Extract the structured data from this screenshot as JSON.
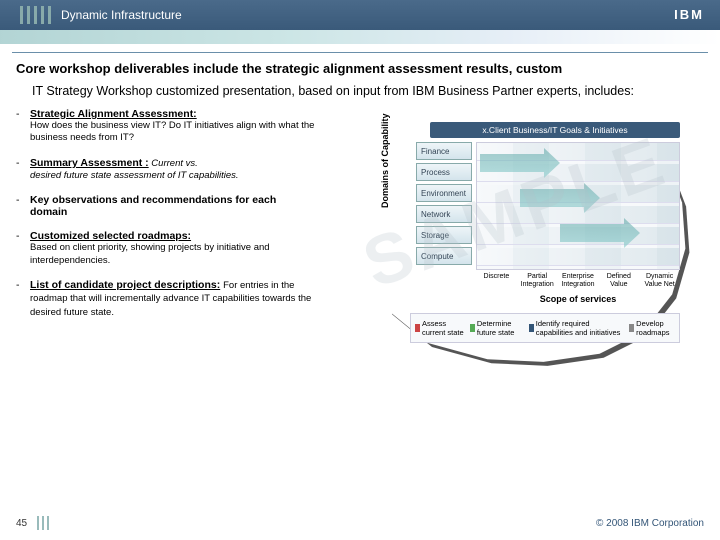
{
  "header": {
    "title": "Dynamic Infrastructure",
    "logo": "IBM"
  },
  "title": "Core workshop deliverables include the strategic alignment assessment results, custom",
  "subtitle": "IT Strategy Workshop customized presentation, based on input from IBM Business Partner experts, includes:",
  "bullets": [
    {
      "head": "Strategic Alignment Assessment:",
      "underline": true,
      "desc": "How does the business view IT?  Do IT initiatives align with what the business needs from IT?"
    },
    {
      "head": "Summary Assessment :",
      "underline": true,
      "tail": " Current vs.",
      "desc": "desired future state assessment of IT capabilities."
    },
    {
      "head": "Key observations and recommendations for each domain",
      "underline": false,
      "desc": ""
    },
    {
      "head": "Customized selected roadmaps:",
      "underline": true,
      "desc": "Based on client priority, showing projects by initiative and interdependencies."
    },
    {
      "head": "List of candidate project descriptions:",
      "underline": true,
      "desc": "For entries in the roadmap that will incrementally advance IT capabilities towards the desired future state."
    }
  ],
  "watermark": "SAMPLE",
  "chart_data": {
    "type": "table",
    "title": "x.Client  Business/IT Goals & Initiatives",
    "ylabel": "Domains of Capability",
    "categories": [
      "Finance",
      "Process",
      "Environment",
      "Network",
      "Storage",
      "Compute"
    ],
    "xlabel": "Scope of services",
    "x": [
      "Discrete",
      "Partial Integration",
      "Enterprise Integration",
      "Defined Value",
      "Dynamic Value Net"
    ],
    "legend": [
      {
        "swatch": "sw-red",
        "label": "Assess current state"
      },
      {
        "swatch": "sw-grn",
        "label": "Determine future state"
      },
      {
        "swatch": "sw-nvy",
        "label": "Identify required capabilities and initiatives"
      },
      {
        "swatch": "sw-gry",
        "label": "Develop roadmaps"
      }
    ]
  },
  "footer": {
    "slide": "45",
    "copyright": "© 2008 IBM Corporation"
  }
}
